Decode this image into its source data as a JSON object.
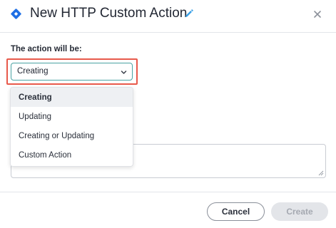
{
  "dialog": {
    "title": "New HTTP Custom Action",
    "logo_icon": "diamond-logo-icon",
    "edit_icon": "pencil-icon",
    "close_icon": "close-icon"
  },
  "form": {
    "action_label": "The action will be:",
    "select": {
      "value": "Creating",
      "icon": "chevron-down-icon"
    },
    "options": [
      {
        "label": "Creating",
        "selected": true
      },
      {
        "label": "Updating",
        "selected": false
      },
      {
        "label": "Creating or Updating",
        "selected": false
      },
      {
        "label": "Custom Action",
        "selected": false
      }
    ]
  },
  "footer": {
    "cancel_label": "Cancel",
    "create_label": "Create"
  },
  "colors": {
    "brand": "#1f6fe5",
    "edit_icon": "#3aa0e6",
    "highlight_border": "#e8594b",
    "select_border": "#4aa3a3",
    "disabled_button_bg": "#e3e5e9"
  }
}
